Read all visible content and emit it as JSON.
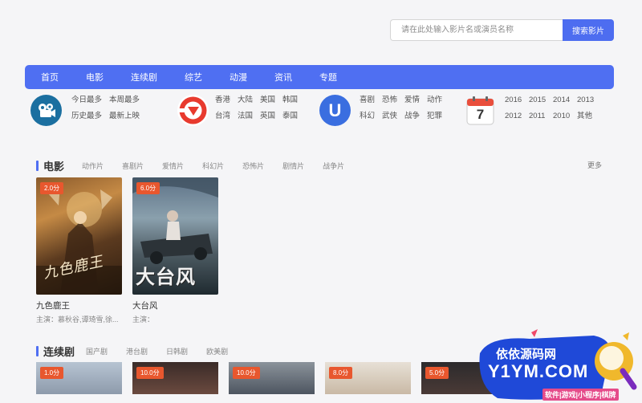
{
  "search": {
    "placeholder": "请在此处输入影片名或演员名称",
    "button": "搜索影片"
  },
  "nav": [
    "首页",
    "电影",
    "连续剧",
    "综艺",
    "动漫",
    "资讯",
    "专题"
  ],
  "quick": {
    "group1": [
      "今日最多",
      "本周最多",
      "历史最多",
      "最新上映"
    ],
    "group2": [
      "香港",
      "大陆",
      "美国",
      "韩国",
      "台湾",
      "法国",
      "英国",
      "泰国"
    ],
    "group3": [
      "喜剧",
      "恐怖",
      "爱情",
      "动作",
      "科幻",
      "武侠",
      "战争",
      "犯罪"
    ],
    "group4": [
      "2016",
      "2015",
      "2014",
      "2013",
      "2012",
      "2011",
      "2010",
      "其他"
    ],
    "calendar_day": "7",
    "icon_letter": "U"
  },
  "movies": {
    "title": "电影",
    "tabs": [
      "动作片",
      "喜剧片",
      "爱情片",
      "科幻片",
      "恐怖片",
      "剧情片",
      "战争片"
    ],
    "more": "更多",
    "items": [
      {
        "name": "九色鹿王",
        "actors": "主演：慕秋谷,谭琦雪,徐...",
        "score": "2.0分",
        "poster_text": "九色鹿王"
      },
      {
        "name": "大台风",
        "actors": "主演：",
        "score": "6.0分",
        "poster_text": "大台风"
      }
    ]
  },
  "series": {
    "title": "连续剧",
    "tabs": [
      "国产剧",
      "港台剧",
      "日韩剧",
      "欧美剧"
    ],
    "scores": [
      "1.0分",
      "10.0分",
      "10.0分",
      "8.0分",
      "5.0分"
    ]
  },
  "watermark": {
    "line1": "依依源码网",
    "line2": "Y1YM.COM",
    "line3": "软件|游戏|小程序|棋牌"
  },
  "colors": {
    "accent": "#4f6ff2",
    "score_badge": "#e8572e"
  }
}
